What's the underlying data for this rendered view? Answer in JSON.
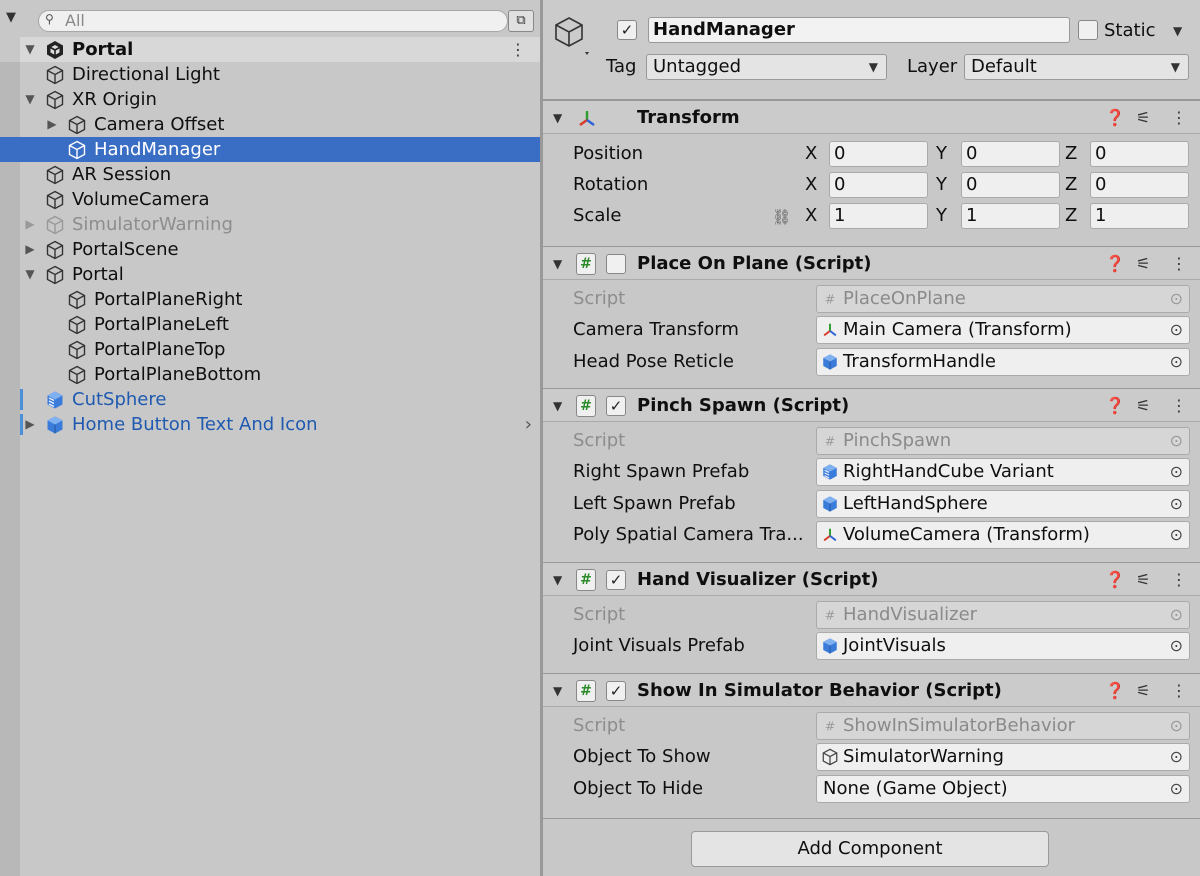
{
  "hierarchy": {
    "search_placeholder": "All",
    "scene_name": "Portal",
    "rows": [
      {
        "label": "Directional Light",
        "indent": 1,
        "arrow": "",
        "icon": "cube-outline-icon",
        "style": ""
      },
      {
        "label": "XR Origin",
        "indent": 1,
        "arrow": "expanded",
        "icon": "cube-outline-icon",
        "style": ""
      },
      {
        "label": "Camera Offset",
        "indent": 2,
        "arrow": "collapsed",
        "icon": "cube-outline-icon",
        "style": ""
      },
      {
        "label": "HandManager",
        "indent": 2,
        "arrow": "",
        "icon": "cube-outline-icon",
        "style": "selected"
      },
      {
        "label": "AR Session",
        "indent": 1,
        "arrow": "",
        "icon": "cube-outline-icon",
        "style": ""
      },
      {
        "label": "VolumeCamera",
        "indent": 1,
        "arrow": "",
        "icon": "cube-outline-icon",
        "style": ""
      },
      {
        "label": "SimulatorWarning",
        "indent": 1,
        "arrow": "collapsed",
        "icon": "cube-outline-icon",
        "style": "disabled"
      },
      {
        "label": "PortalScene",
        "indent": 1,
        "arrow": "collapsed",
        "icon": "cube-outline-icon",
        "style": ""
      },
      {
        "label": "Portal",
        "indent": 1,
        "arrow": "expanded",
        "icon": "cube-outline-icon",
        "style": ""
      },
      {
        "label": "PortalPlaneRight",
        "indent": 2,
        "arrow": "",
        "icon": "cube-outline-icon",
        "style": ""
      },
      {
        "label": "PortalPlaneLeft",
        "indent": 2,
        "arrow": "",
        "icon": "cube-outline-icon",
        "style": ""
      },
      {
        "label": "PortalPlaneTop",
        "indent": 2,
        "arrow": "",
        "icon": "cube-outline-icon",
        "style": ""
      },
      {
        "label": "PortalPlaneBottom",
        "indent": 2,
        "arrow": "",
        "icon": "cube-outline-icon",
        "style": ""
      },
      {
        "label": "CutSphere",
        "indent": 1,
        "arrow": "",
        "icon": "prefab-variant-icon",
        "style": "prefab-modified"
      },
      {
        "label": "Home Button Text And Icon",
        "indent": 1,
        "arrow": "collapsed",
        "icon": "prefab-icon",
        "style": "prefab-modified"
      }
    ]
  },
  "inspector": {
    "object_name": "HandManager",
    "active_checked": true,
    "static_label": "Static",
    "tag_label": "Tag",
    "tag_value": "Untagged",
    "layer_label": "Layer",
    "layer_value": "Default",
    "transform": {
      "title": "Transform",
      "rows": [
        {
          "label": "Position",
          "x": "0",
          "y": "0",
          "z": "0"
        },
        {
          "label": "Rotation",
          "x": "0",
          "y": "0",
          "z": "0"
        },
        {
          "label": "Scale",
          "x": "1",
          "y": "1",
          "z": "1"
        }
      ],
      "axes": {
        "x": "X",
        "y": "Y",
        "z": "Z"
      }
    },
    "components": [
      {
        "title": "Place On Plane (Script)",
        "enabled": false,
        "fields": [
          {
            "label": "Script",
            "value": "PlaceOnPlane",
            "icon": "script-icon",
            "readonly": true
          },
          {
            "label": "Camera Transform",
            "value": "Main Camera (Transform)",
            "icon": "transform-icon",
            "readonly": false
          },
          {
            "label": "Head Pose Reticle",
            "value": "TransformHandle",
            "icon": "prefab-icon",
            "readonly": false
          }
        ]
      },
      {
        "title": "Pinch Spawn (Script)",
        "enabled": true,
        "fields": [
          {
            "label": "Script",
            "value": "PinchSpawn",
            "icon": "script-icon",
            "readonly": true
          },
          {
            "label": "Right Spawn Prefab",
            "value": "RightHandCube Variant",
            "icon": "prefab-variant-icon",
            "readonly": false
          },
          {
            "label": "Left Spawn Prefab",
            "value": "LeftHandSphere",
            "icon": "prefab-icon",
            "readonly": false
          },
          {
            "label": "Poly Spatial Camera Tra...",
            "value": "VolumeCamera (Transform)",
            "icon": "transform-icon",
            "readonly": false
          }
        ]
      },
      {
        "title": "Hand Visualizer (Script)",
        "enabled": true,
        "fields": [
          {
            "label": "Script",
            "value": "HandVisualizer",
            "icon": "script-icon",
            "readonly": true
          },
          {
            "label": "Joint Visuals Prefab",
            "value": "JointVisuals",
            "icon": "prefab-icon",
            "readonly": false
          }
        ]
      },
      {
        "title": "Show In Simulator Behavior (Script)",
        "enabled": true,
        "fields": [
          {
            "label": "Script",
            "value": "ShowInSimulatorBehavior",
            "icon": "script-icon",
            "readonly": true
          },
          {
            "label": "Object To Show",
            "value": "SimulatorWarning",
            "icon": "cube-outline-icon",
            "readonly": false
          },
          {
            "label": "Object To Hide",
            "value": "None (Game Object)",
            "icon": "",
            "readonly": false
          }
        ]
      }
    ],
    "add_component_label": "Add Component"
  },
  "colors": {
    "selection": "#3a6ec5",
    "prefab_text": "#1f5ab0",
    "prefab_icon": "#3b7bd9"
  }
}
